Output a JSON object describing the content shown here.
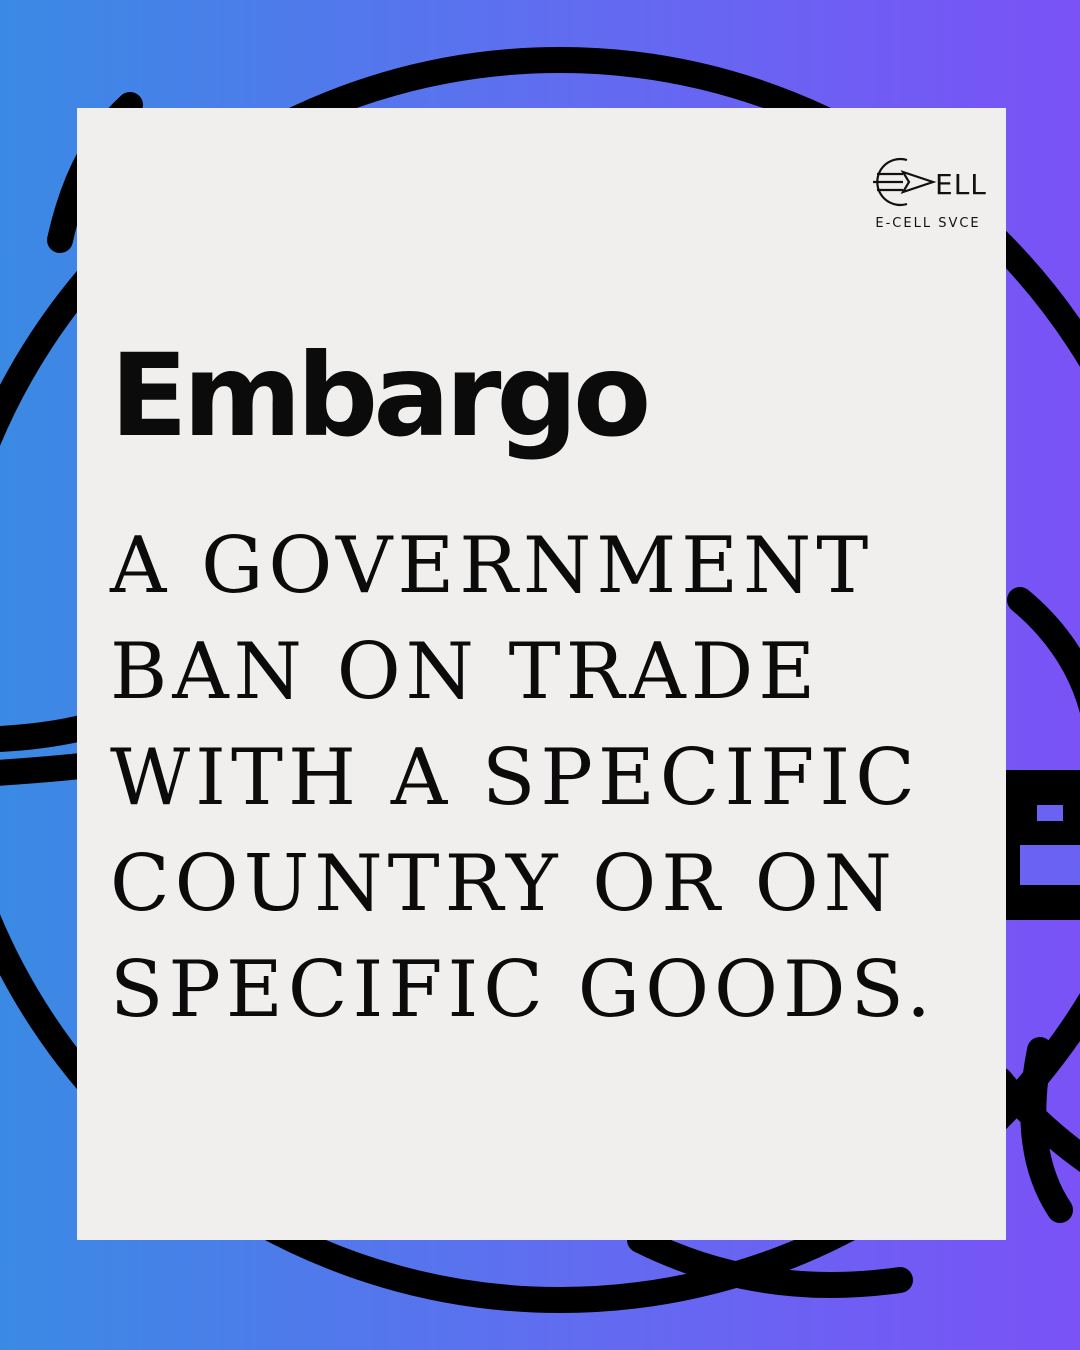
{
  "background": {
    "gradient_start": "#3a8ae4",
    "gradient_end": "#7a52f6",
    "decoration_icon": "globe-outline-icon"
  },
  "card": {
    "color": "#f0efee"
  },
  "logo": {
    "icon": "paper-plane-icon",
    "wordmark": "ELL",
    "caption": "E-CELL SVCE"
  },
  "term": "Embargo",
  "definition": "A GOVERNMENT BAN ON TRADE WITH A SPECIFIC COUNTRY OR ON SPECIFIC GOODS."
}
